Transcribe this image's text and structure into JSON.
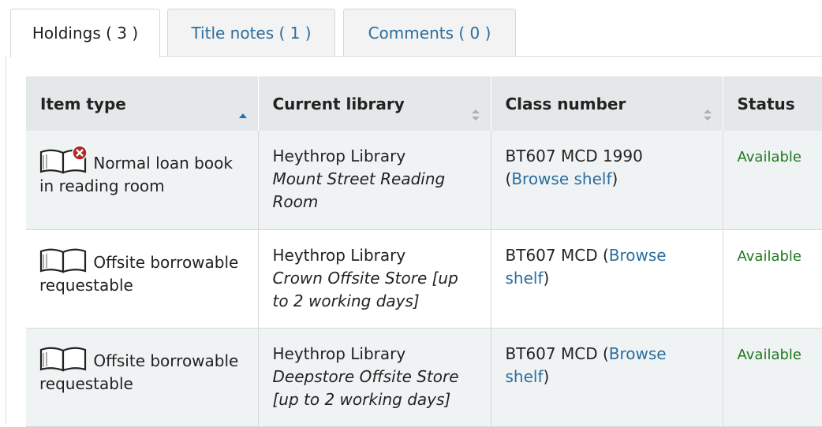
{
  "tabs": [
    {
      "label": "Holdings ( 3 )",
      "active": true
    },
    {
      "label": "Title notes ( 1 )",
      "active": false
    },
    {
      "label": "Comments ( 0 )",
      "active": false
    }
  ],
  "table": {
    "headers": [
      "Item type",
      "Current library",
      "Class number",
      "Status"
    ],
    "rows": [
      {
        "item_type": "Normal loan book in reading room",
        "icon": "book-not-for-loan-icon",
        "library": "Heythrop Library",
        "location": "Mount Street Reading Room",
        "class_number": "BT607 MCD 1990 (",
        "browse_label": "Browse shelf",
        "class_suffix": ")",
        "status": "Available"
      },
      {
        "item_type": "Offsite borrowable requestable",
        "icon": "book-icon",
        "library": "Heythrop Library",
        "location": "Crown Offsite Store [up to 2 working days]",
        "class_number": "BT607 MCD (",
        "browse_label": "Browse shelf",
        "class_suffix": ")",
        "status": "Available"
      },
      {
        "item_type": "Offsite borrowable requestable",
        "icon": "book-icon",
        "library": "Heythrop Library",
        "location": "Deepstore Offsite Store [up to 2 working days]",
        "class_number": "BT607 MCD (",
        "browse_label": "Browse shelf",
        "class_suffix": ")",
        "status": "Available"
      }
    ]
  },
  "colors": {
    "link": "#2b6e9c",
    "available": "#1e7a1e",
    "header_bg": "#e5e8e9",
    "sort_active": "#1a73b8"
  }
}
